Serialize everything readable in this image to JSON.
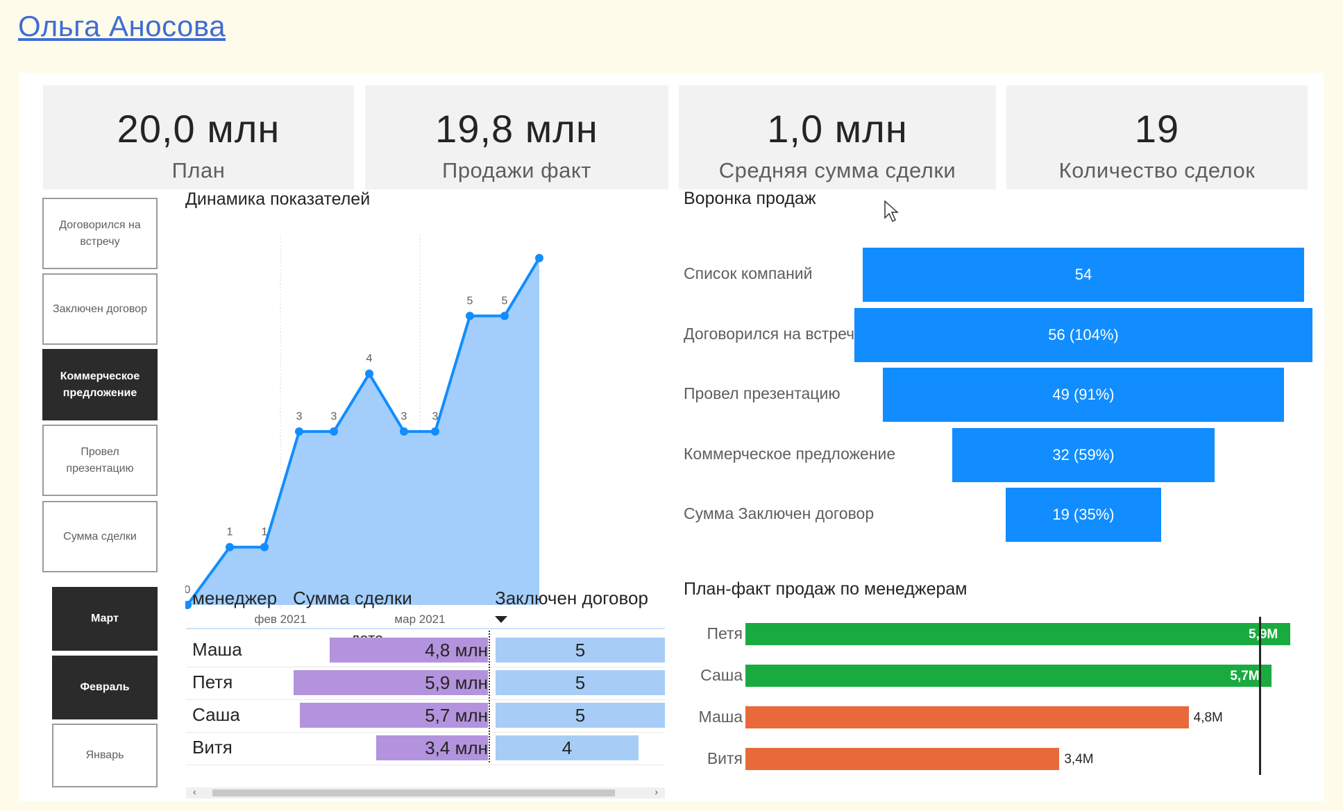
{
  "author": "Ольга Аносова",
  "kpis": [
    {
      "value": "20,0 млн",
      "label": "План"
    },
    {
      "value": "19,8 млн",
      "label": "Продажи факт"
    },
    {
      "value": "1,0 млн",
      "label": "Средняя сумма сделки"
    },
    {
      "value": "19",
      "label": "Количество сделок"
    }
  ],
  "stage_buttons": [
    {
      "label": "Договорился на встречу",
      "selected": false
    },
    {
      "label": "Заключен договор",
      "selected": false
    },
    {
      "label": "Коммерческое предложение",
      "selected": true
    },
    {
      "label": "Провел презентацию",
      "selected": false
    },
    {
      "label": "Сумма сделки",
      "selected": false
    }
  ],
  "month_buttons": [
    {
      "label": "Март",
      "selected": true
    },
    {
      "label": "Февраль",
      "selected": true
    },
    {
      "label": "Январь",
      "selected": false
    }
  ],
  "line_chart": {
    "title": "Динамика показателей",
    "xlabel": "дата",
    "ticks": [
      "фев 2021",
      "мар 2021"
    ]
  },
  "funnel": {
    "title": "Воронка продаж",
    "stages": [
      {
        "label": "Список компаний",
        "value": 54,
        "text": "54"
      },
      {
        "label": "Договорился на встречу",
        "value": 56,
        "text": "56 (104%)"
      },
      {
        "label": "Провел презентацию",
        "value": 49,
        "text": "49 (91%)"
      },
      {
        "label": "Коммерческое предложение",
        "value": 32,
        "text": "32 (59%)"
      },
      {
        "label": "Сумма Заключен договор",
        "value": 19,
        "text": "19 (35%)"
      }
    ]
  },
  "table": {
    "headers": {
      "manager": "менеджер",
      "sum": "Сумма сделки",
      "deals": "Заключен договор"
    },
    "rows": [
      {
        "manager": "Маша",
        "sum": 4.8,
        "sum_text": "4,8 млн",
        "deals": 5,
        "deals_text": "5"
      },
      {
        "manager": "Петя",
        "sum": 5.9,
        "sum_text": "5,9 млн",
        "deals": 5,
        "deals_text": "5"
      },
      {
        "manager": "Саша",
        "sum": 5.7,
        "sum_text": "5,7 млн",
        "deals": 5,
        "deals_text": "5"
      },
      {
        "manager": "Витя",
        "sum": 3.4,
        "sum_text": "3,4 млн",
        "deals": 4,
        "deals_text": "4"
      }
    ]
  },
  "plan_fact": {
    "title": "План-факт продаж по менеджерам",
    "target": 5.0,
    "rows": [
      {
        "name": "Петя",
        "value": 5.9,
        "text": "5,9M",
        "color": "#1aab40"
      },
      {
        "name": "Саша",
        "value": 5.7,
        "text": "5,7M",
        "color": "#1aab40"
      },
      {
        "name": "Маша",
        "value": 4.8,
        "text": "4,8M",
        "color": "#e8693a"
      },
      {
        "name": "Витя",
        "value": 3.4,
        "text": "3,4M",
        "color": "#e8693a"
      }
    ]
  },
  "chart_data": {
    "type": "area",
    "title": "Динамика показателей",
    "xlabel": "дата",
    "ylabel": "",
    "x_ticks": [
      "фев 2021",
      "мар 2021"
    ],
    "values": [
      0,
      1,
      1,
      3,
      3,
      4,
      3,
      3,
      5,
      5,
      6
    ],
    "labels": [
      "0",
      "1",
      "1",
      "3",
      "3",
      "4",
      "3",
      "3",
      "5",
      "5",
      ""
    ],
    "ylim": [
      0,
      6
    ],
    "grid": true
  },
  "colors": {
    "accent": "#118dff",
    "area_fill": "#a3cefc",
    "line": "#118dff",
    "sum_bar": "#b393dd",
    "deals_bar": "#a7cdf6",
    "above_plan": "#1aab40",
    "below_plan": "#e8693a"
  }
}
